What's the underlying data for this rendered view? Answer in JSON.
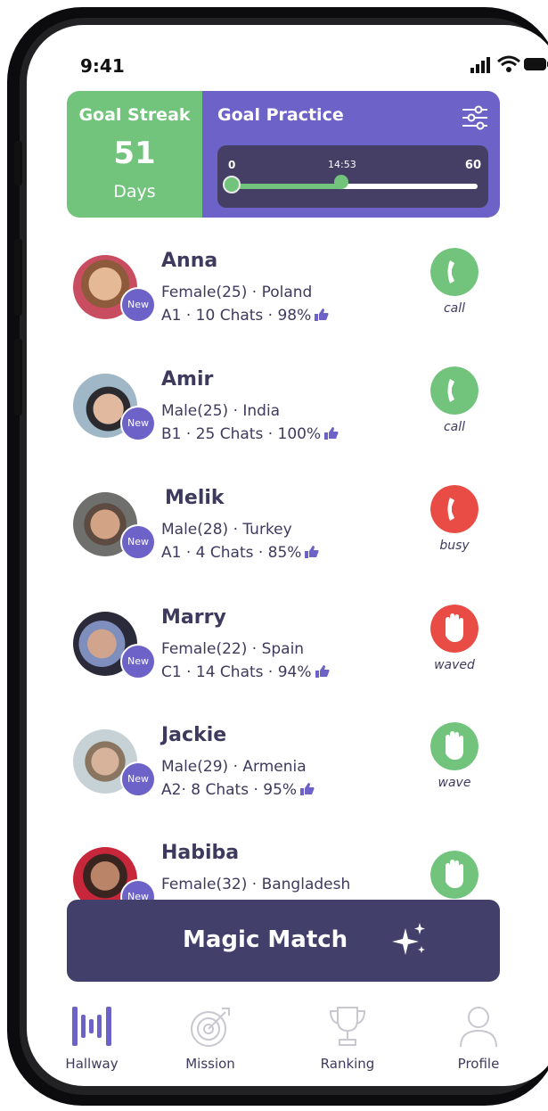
{
  "status_bar": {
    "time": "9:41"
  },
  "goal_streak": {
    "title": "Goal Streak",
    "value": "51",
    "unit": "Days"
  },
  "goal_practice": {
    "title": "Goal Practice",
    "slider": {
      "min_label": "0",
      "current_label": "14:53",
      "max_label": "60",
      "start_fraction": 0,
      "current_fraction": 0.45
    }
  },
  "users": [
    {
      "name": "Anna",
      "info": "Female(25) · Poland",
      "stats": "A1 · 10 Chats · 98%",
      "badge": "New",
      "action": "call",
      "action_label": "call",
      "action_color": "#72c47c"
    },
    {
      "name": "Amir",
      "info": "Male(25) · India",
      "stats": "B1 · 25 Chats · 100%",
      "badge": "New",
      "action": "call",
      "action_label": "call",
      "action_color": "#72c47c"
    },
    {
      "name": "Melik",
      "info": "Male(28) · Turkey",
      "stats": "A1 · 4 Chats · 85%",
      "badge": "New",
      "action": "busy",
      "action_label": "busy",
      "action_color": "#e84c44"
    },
    {
      "name": "Marry",
      "info": "Female(22) · Spain",
      "stats": "C1 · 14 Chats · 94%",
      "badge": "New",
      "action": "waved",
      "action_label": "waved",
      "action_color": "#e84c44"
    },
    {
      "name": "Jackie",
      "info": "Male(29) · Armenia",
      "stats": "A2· 8 Chats · 95%",
      "badge": "New",
      "action": "wave",
      "action_label": "wave",
      "action_color": "#72c47c"
    },
    {
      "name": "Habiba",
      "info": "Female(32) · Bangladesh",
      "stats": "",
      "badge": "New",
      "action": "wave",
      "action_label": "",
      "action_color": "#72c47c"
    }
  ],
  "magic_match": {
    "label": "Magic Match"
  },
  "tabs": [
    {
      "label": "Hallway",
      "icon": "hallway-icon",
      "active": true
    },
    {
      "label": "Mission",
      "icon": "target-icon",
      "active": false
    },
    {
      "label": "Ranking",
      "icon": "trophy-icon",
      "active": false
    },
    {
      "label": "Profile",
      "icon": "profile-icon",
      "active": false
    }
  ],
  "colors": {
    "primary": "#6c62c8",
    "green": "#72c47c",
    "red": "#e84c44",
    "dark": "#433f6b",
    "text": "#3e3a5e"
  }
}
